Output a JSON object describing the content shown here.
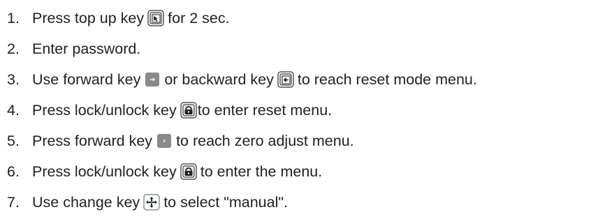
{
  "steps": [
    {
      "number": "1.",
      "before": "Press top up key",
      "icon": "top-up-key-icon",
      "after": "for 2 sec."
    },
    {
      "number": "2.",
      "text": "Enter password."
    },
    {
      "number": "3.",
      "before": "Use forward key",
      "icon1": "forward-key-icon",
      "middle": "or backward key",
      "icon2": "backward-key-icon",
      "after": "to reach reset mode menu."
    },
    {
      "number": "4.",
      "before": "Press lock/unlock key",
      "icon": "lock-unlock-key-icon",
      "after": "to enter reset menu."
    },
    {
      "number": "5.",
      "before": "Press forward key",
      "icon": "forward-key-icon",
      "after": "to reach zero adjust menu."
    },
    {
      "number": "6.",
      "before": "Press lock/unlock key",
      "icon": "lock-unlock-key-icon",
      "after": "to enter the menu."
    },
    {
      "number": "7.",
      "before": "Use change key",
      "icon": "change-key-icon",
      "after": "to select \"manual\"."
    }
  ]
}
